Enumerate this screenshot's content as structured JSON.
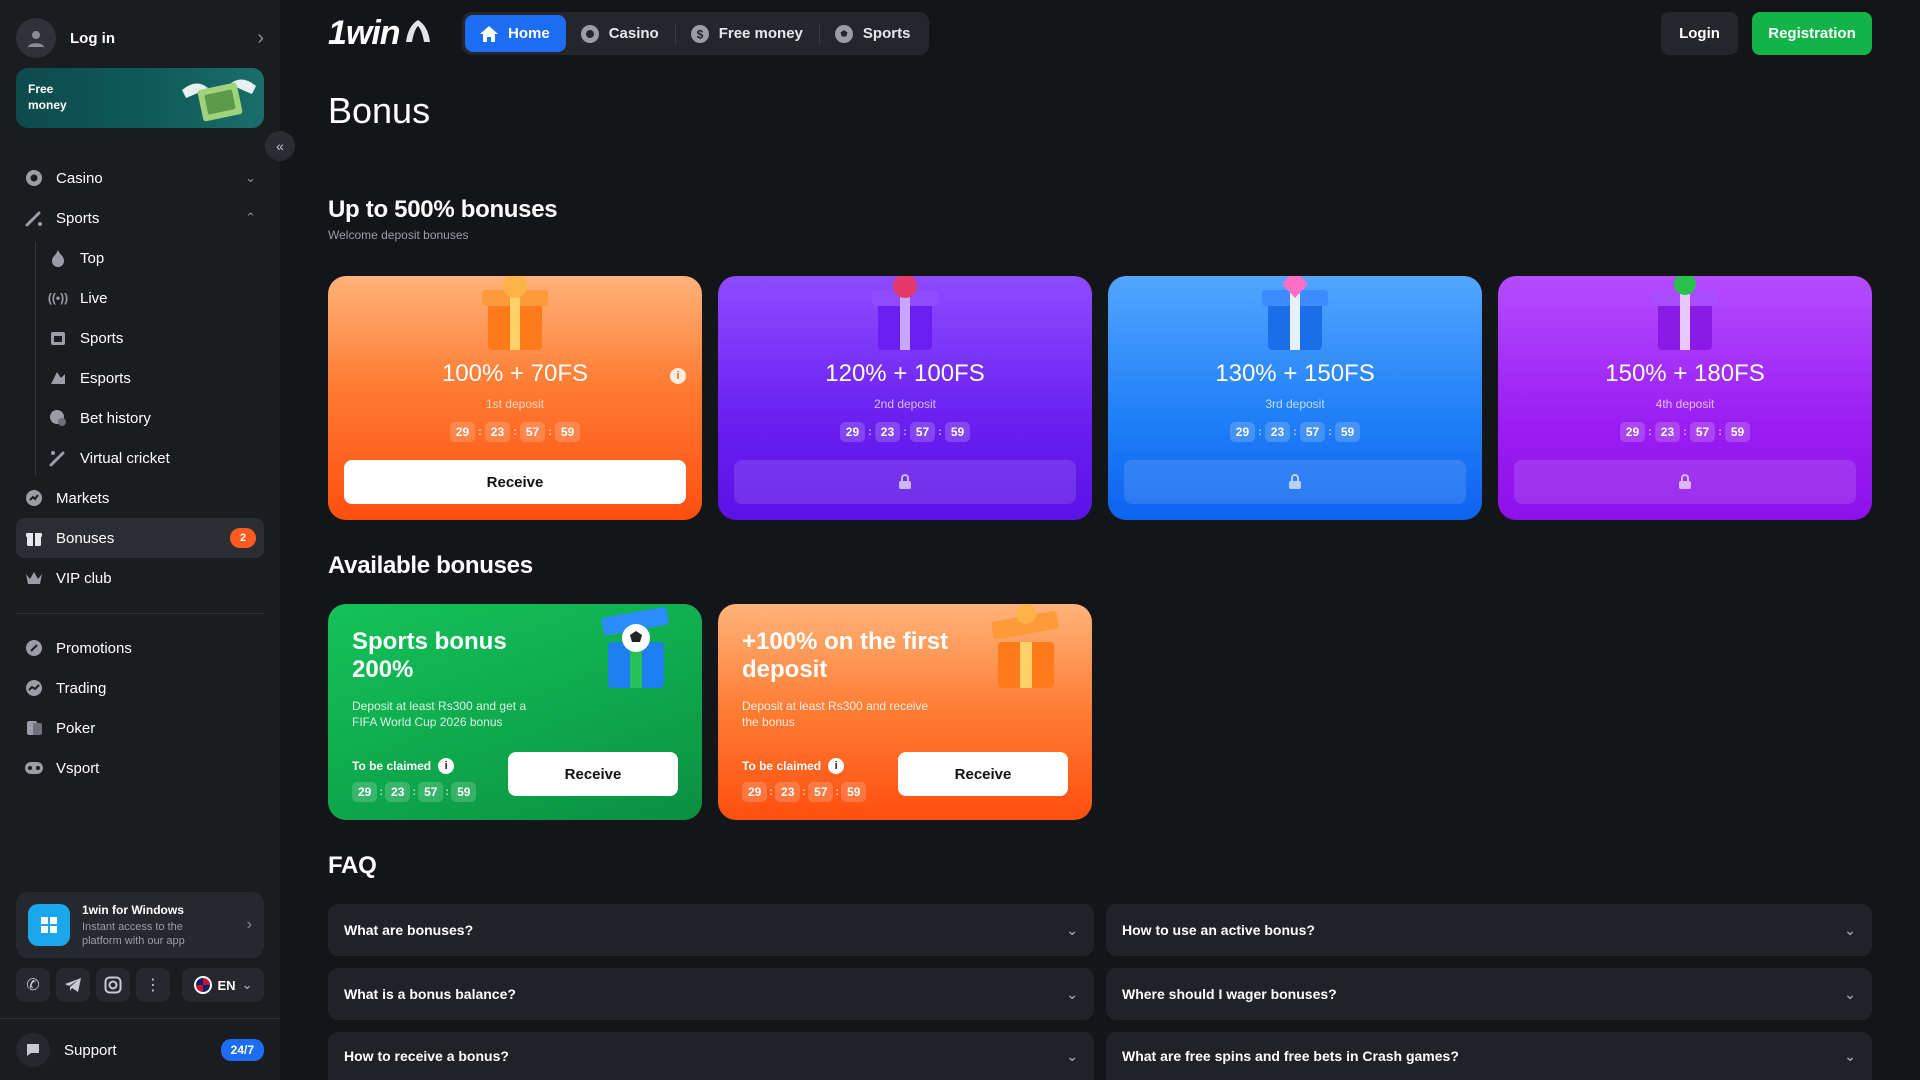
{
  "sidebar": {
    "login_label": "Log in",
    "free_banner": "Free money",
    "menu": [
      {
        "label": "Casino",
        "icon": "casino-chip-icon"
      },
      {
        "label": "Sports",
        "icon": "sports-icon"
      },
      {
        "label": "Top",
        "icon": "flame-icon"
      },
      {
        "label": "Live",
        "icon": "broadcast-icon"
      },
      {
        "label": "Sports",
        "icon": "calendar-icon"
      },
      {
        "label": "Esports",
        "icon": "esports-icon"
      },
      {
        "label": "Bet history",
        "icon": "history-icon"
      },
      {
        "label": "Virtual cricket",
        "icon": "cricket-icon"
      },
      {
        "label": "Markets",
        "icon": "markets-icon"
      },
      {
        "label": "Bonuses",
        "icon": "gift-icon",
        "badge": "2"
      },
      {
        "label": "VIP club",
        "icon": "crown-icon"
      },
      {
        "label": "Promotions",
        "icon": "promotions-icon"
      },
      {
        "label": "Trading",
        "icon": "trading-icon"
      },
      {
        "label": "Poker",
        "icon": "poker-icon"
      },
      {
        "label": "Vsport",
        "icon": "gamepad-icon"
      }
    ],
    "app": {
      "title": "1win for Windows",
      "subtitle": "Instant access to the platform with our app"
    },
    "language": "EN",
    "support": {
      "label": "Support",
      "badge": "24/7"
    }
  },
  "header": {
    "logo": "1win",
    "tabs": [
      "Home",
      "Casino",
      "Free money",
      "Sports"
    ],
    "login_button": "Login",
    "register_button": "Registration"
  },
  "page": {
    "title": "Bonus",
    "welcome_title": "Up to 500% bonuses",
    "welcome_subtitle": "Welcome deposit bonuses",
    "deposit_cards": [
      {
        "title": "100% + 70FS",
        "deposit": "1st deposit",
        "timer": [
          "29",
          "23",
          "57",
          "59"
        ],
        "button": "Receive"
      },
      {
        "title": "120% + 100FS",
        "deposit": "2nd deposit",
        "timer": [
          "29",
          "23",
          "57",
          "59"
        ]
      },
      {
        "title": "130% + 150FS",
        "deposit": "3rd deposit",
        "timer": [
          "29",
          "23",
          "57",
          "59"
        ]
      },
      {
        "title": "150% + 180FS",
        "deposit": "4th deposit",
        "timer": [
          "29",
          "23",
          "57",
          "59"
        ]
      }
    ],
    "available_title": "Available bonuses",
    "available_cards": [
      {
        "title": "Sports bonus 200%",
        "description": "Deposit at least Rs300 and get a FIFA World Cup 2026 bonus",
        "claim_label": "To be claimed",
        "timer": [
          "29",
          "23",
          "57",
          "59"
        ],
        "button": "Receive"
      },
      {
        "title": "+100% on the first deposit",
        "description": "Deposit at least Rs300 and receive the bonus",
        "claim_label": "To be claimed",
        "timer": [
          "29",
          "23",
          "57",
          "59"
        ],
        "button": "Receive"
      }
    ],
    "faq_title": "FAQ",
    "faq": [
      "What are bonuses?",
      "How to use an active bonus?",
      "What is a bonus balance?",
      "Where should I wager bonuses?",
      "How to receive a bonus?",
      "What are free spins and free bets in Crash games?"
    ]
  },
  "colors": {
    "accent": "#1c6df2",
    "register": "#12b349",
    "badge": "#ff5a1f",
    "background": "#141518"
  }
}
